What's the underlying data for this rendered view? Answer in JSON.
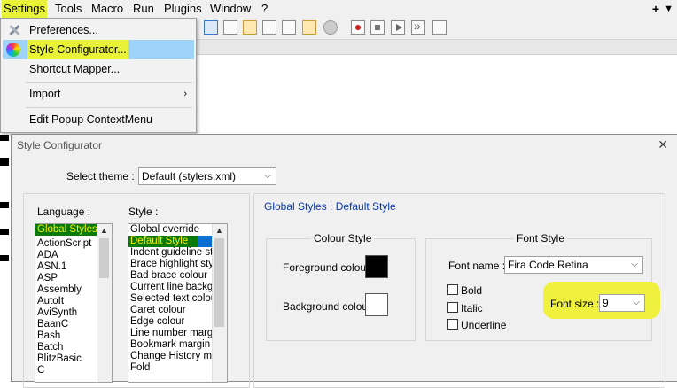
{
  "menubar": {
    "items": [
      "Settings",
      "Tools",
      "Macro",
      "Run",
      "Plugins",
      "Window",
      "?"
    ],
    "plus": "+",
    "close": "▼"
  },
  "dropdown": {
    "items": [
      {
        "label": "Preferences...",
        "icon": "preferences-icon"
      },
      {
        "label": "Style Configurator...",
        "icon": "color-wheel-icon"
      },
      {
        "label": "Shortcut Mapper..."
      },
      {
        "label": "Import",
        "submenu": true
      },
      {
        "label": "Edit Popup ContextMenu"
      }
    ],
    "submenu_arrow": "›"
  },
  "dialog": {
    "title": "Style Configurator",
    "close": "✕",
    "theme_label": "Select theme :",
    "theme_value": "Default (stylers.xml)",
    "language_label": "Language :",
    "languages": [
      "Global Styles",
      "ActionScript",
      "ADA",
      "ASN.1",
      "ASP",
      "Assembly",
      "AutoIt",
      "AviSynth",
      "BaanC",
      "Bash",
      "Batch",
      "BlitzBasic",
      "C"
    ],
    "style_label": "Style :",
    "styles": [
      "Global override",
      "Default Style",
      "Indent guideline style",
      "Brace highlight style",
      "Bad brace colour",
      "Current line background",
      "Selected text colour",
      "Caret colour",
      "Edge colour",
      "Line number margin",
      "Bookmark margin",
      "Change History margin",
      "Fold"
    ],
    "section_title": "Global Styles : Default Style",
    "colour_style": {
      "label": "Colour Style",
      "foreground_label": "Foreground colour",
      "foreground_color": "#000000",
      "background_label": "Background colour",
      "background_color": "#ffffff"
    },
    "font_style": {
      "label": "Font Style",
      "font_name_label": "Font name :",
      "font_name": "Fira Code Retina",
      "bold": "Bold",
      "italic": "Italic",
      "underline": "Underline",
      "font_size_label": "Font size :",
      "font_size": "9"
    },
    "combo_arrow": "⌵"
  },
  "colors": {
    "highlight_yellow": "#e8f238",
    "menu_hover": "#9fd3f7",
    "selection_green": "#0a7a0a",
    "link_blue": "#0a3aa8"
  }
}
